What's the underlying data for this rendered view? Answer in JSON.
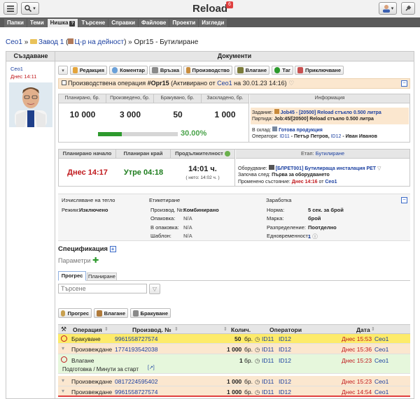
{
  "app": {
    "title": "Reload",
    "notif_count": "6"
  },
  "nav": {
    "tabs": [
      "Папки",
      "Теми",
      "Нишка",
      "Търсене",
      "Справки",
      "Файлове",
      "Проекти",
      "Изгледи"
    ],
    "active": "Нишка"
  },
  "breadcrumb": {
    "c1": "Ceo1",
    "c2": "Завод 1",
    "c3": "Ц-р на дейност",
    "c4": "Opr15 - Бутилиране"
  },
  "left": {
    "heading": "Създаване",
    "author": "Ceo1",
    "when": "Днес 14:11"
  },
  "doc": {
    "heading": "Документи",
    "buttons": [
      "Редакция",
      "Коментар",
      "Връзка",
      "Производство",
      "Влагане",
      "Таг",
      "Приключване"
    ],
    "op_prefix": "Производствена операция",
    "op_code": "#Opr15",
    "op_activated": "(Активирано от",
    "op_user": "Ceo1",
    "op_date": "на 30.01.23 14:16)"
  },
  "stats": {
    "headers": [
      "Планирано, бр.",
      "Произведено, бр.",
      "Бракувано, бр.",
      "Заскладено, бр."
    ],
    "values": [
      "10 000",
      "3 000",
      "50",
      "1 000"
    ],
    "progress_label": "30.00%",
    "progress": 0.3
  },
  "info": {
    "heading": "Информация",
    "task_label": "Задание:",
    "task_value": "Job45 - [20500] Reload стъкло 0.500 литра",
    "batch_label": "Партида:",
    "batch_value": "Job:45/[20500] Reload стъкло 0.500 литра",
    "stock_label": "В склад:",
    "stock_value": "Готова продукция",
    "operators_label": "Оператори:",
    "op1": "ID11",
    "op1_name": "- Петър Петров,",
    "op2": "ID12",
    "op2_name": "- Иван Иванов"
  },
  "timing": {
    "headers": [
      "Планирано начало",
      "Планиран край",
      "Продължителност"
    ],
    "start": "Днес 14:17",
    "end": "Утре 04:18",
    "duration": "14:01 ч.",
    "net": "( нето: 14:02 ч. )"
  },
  "stage": {
    "label": "Етап:",
    "name": "Бутилиране",
    "equipment_label": "Оборудване:",
    "equipment_value": "[БЛРЕТ001] Бутилираща инсталация PET",
    "starts_label": "Започва след:",
    "starts_value": "Първа за оборудването",
    "changed_label": "Променено състояние:",
    "changed_when": "Днес 14:16",
    "changed_from": "от",
    "changed_user": "Ceo1"
  },
  "details": {
    "h1": "Изчисляване на тегло",
    "h2": "Етикетиране",
    "h3": "Заработка",
    "mode_label": "Режим:",
    "mode_value": "Изключено",
    "prodno_label": "Производ. №:",
    "prodno_value": "Комбинирано",
    "pack_label": "Опаковка:",
    "pack_value": "N/A",
    "inpack_label": "В опаковка:",
    "inpack_value": "N/A",
    "template_label": "Шаблон:",
    "template_value": "N/A",
    "norm_label": "Норма:",
    "norm_value": "5 сек. за брой",
    "mark_label": "Марка:",
    "mark_value": "брой",
    "dist_label": "Разпределение:",
    "dist_value": "Поотделно",
    "simult_label": "Едновременност:",
    "simult_value": "1"
  },
  "spec": {
    "title": "Спецификация",
    "params": "Параметри"
  },
  "progress_tabs": [
    "Прогрес",
    "Планиране"
  ],
  "search": {
    "placeholder": "Търсене"
  },
  "actions": [
    "Прогрес",
    "Влагане",
    "Бракуване"
  ],
  "table": {
    "headers": [
      "Операция",
      "Производ. №",
      "Колич.",
      "Оператори",
      "Дата"
    ],
    "rows": [
      {
        "op": "Бракуване",
        "no": "9961558727574",
        "qty": "50",
        "unit": "бр.",
        "o1": "ID11",
        "o2": "ID12",
        "date": "Днес 15:53",
        "user": "Ceo1"
      },
      {
        "op": "Произвеждане",
        "no": "1774193542038",
        "qty": "1 000",
        "unit": "бр.",
        "o1": "ID11",
        "o2": "ID12",
        "date": "Днес 15:36",
        "user": "Ceo1"
      },
      {
        "op": "Влагане",
        "no": "",
        "qty": "1",
        "unit": "бр.",
        "o1": "ID11",
        "o2": "ID12",
        "date": "Днес 15:23",
        "user": "Ceo1",
        "sub": "Подготовка / Минути за старт"
      },
      {
        "op": "Произвеждане",
        "no": "0817224595402",
        "qty": "1 000",
        "unit": "бр.",
        "o1": "ID11",
        "o2": "ID12",
        "date": "Днес 15:23",
        "user": "Ceo1"
      },
      {
        "op": "Произвеждане",
        "no": "9961558727574",
        "qty": "1 000",
        "unit": "бр.",
        "o1": "ID11",
        "o2": "ID12",
        "date": "Днес 14:54",
        "user": "Ceo1"
      }
    ]
  },
  "colors": {
    "accent": "#1a3fa0",
    "red": "#c0181c",
    "green": "#1e7d1e",
    "yellow": "#fdeb6a",
    "lightgreen": "#e6f7dc",
    "orange": "#fbe7cf"
  }
}
